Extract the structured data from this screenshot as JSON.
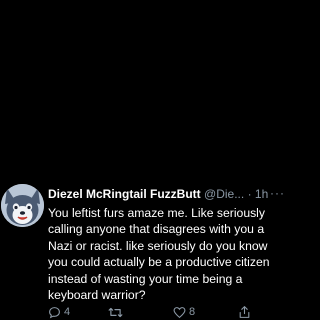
{
  "tweet": {
    "display_name": "Diezel McRingtail FuzzButt",
    "handle": "@Die...",
    "separator": "·",
    "time": "1h",
    "more": "···",
    "text": "You leftist furs amaze me. Like seriously calling anyone that disagrees with you a Nazi or racist. like seriously do you know you could actually be a productive citizen instead of wasting your time being a keyboard warrior?",
    "avatar": "husky-fursona-avatar"
  },
  "actions": {
    "reply_icon": "comment-icon",
    "reply_count": "4",
    "retweet_icon": "retweet-icon",
    "like_icon": "heart-icon",
    "like_count": "8",
    "share_icon": "share-icon"
  },
  "colors": {
    "background": "#000000",
    "text": "#ffffff",
    "muted": "#8b98a5"
  }
}
